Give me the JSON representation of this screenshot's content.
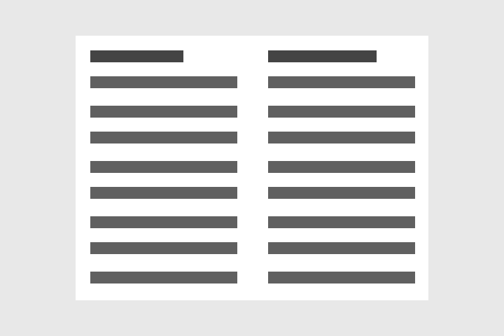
{
  "colors": {
    "background": "#e8e8e8",
    "page": "#ffffff",
    "heading_placeholder": "#444444",
    "line_placeholder": "#606060"
  },
  "document": {
    "columns": [
      {
        "heading_placeholder_count": 1,
        "text_line_placeholder_count": 8
      },
      {
        "heading_placeholder_count": 1,
        "text_line_placeholder_count": 8
      }
    ]
  }
}
